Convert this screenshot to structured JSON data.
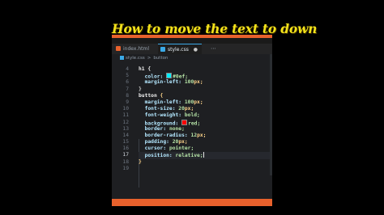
{
  "title": "How to move the text to down",
  "tabs": [
    {
      "label": "index.html",
      "close": ""
    },
    {
      "label": "style.css",
      "close": "●"
    }
  ],
  "tabs_more": "⋯",
  "breadcrumb": {
    "file": "style.css",
    "sep": ">",
    "symbol": "button"
  },
  "colors": {
    "swatch_h1": "#00eeff",
    "swatch_button": "#ff0000",
    "accent": "#e8612c"
  },
  "line_numbers": [
    "4",
    "5",
    "6",
    "7",
    "8",
    "9",
    "10",
    "11",
    "12",
    "13",
    "14",
    "15",
    "16",
    "17",
    "18",
    "19"
  ],
  "code": {
    "l4": "h1 {",
    "l5_prop": "color: ",
    "l5_val": "#0ef;",
    "l6_prop": "margin-left: ",
    "l6_num": "100",
    "l6_unit": "px;",
    "l7": "}",
    "l8_sel": "button ",
    "l8_brace": "{",
    "l9_prop": "margin-left: ",
    "l9_num": "100",
    "l9_unit": "px;",
    "l10_prop": "font-size: ",
    "l10_num": "20",
    "l10_unit": "px;",
    "l11_prop": "font-weight: ",
    "l11_val": "bold;",
    "l12_prop": "background: ",
    "l12_val": "red;",
    "l13_prop": "border: ",
    "l13_val": "none;",
    "l14_prop": "border-radius: ",
    "l14_num": "12",
    "l14_unit": "px;",
    "l15_prop": "padding: ",
    "l15_num": "20",
    "l15_unit": "px;",
    "l16_prop": "cursor: ",
    "l16_val": "pointer;",
    "l17_prop": "position: ",
    "l17_val": "relative;",
    "l18": "}"
  }
}
